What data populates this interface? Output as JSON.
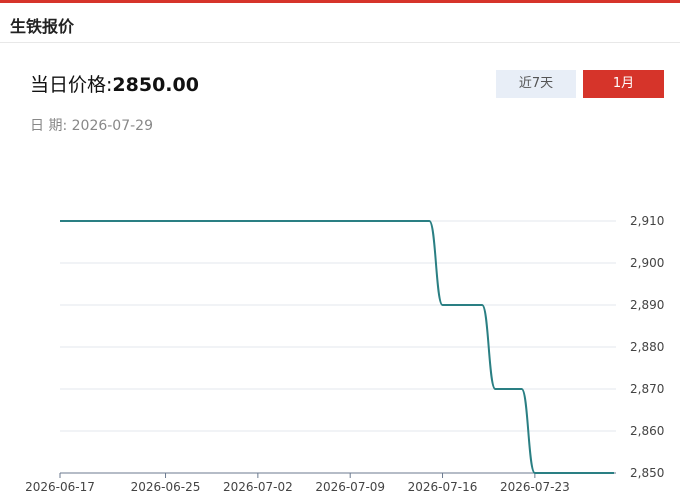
{
  "header": {
    "title": "生铁报价"
  },
  "price": {
    "label": "当日价格:",
    "value": "2850.00"
  },
  "date": {
    "label": "日 期:",
    "value": "2026-07-29"
  },
  "tabs": [
    {
      "label": "近7天",
      "active": false
    },
    {
      "label": "1月",
      "active": true
    }
  ],
  "colors": {
    "accent": "#d6342a",
    "line": "#2a7f83",
    "tab_inactive": "#e8eef7",
    "grid": "#e3e7ee"
  },
  "chart_data": {
    "type": "line",
    "title": "",
    "xlabel": "",
    "ylabel": "",
    "x": [
      "2026-06-17",
      "2026-06-18",
      "2026-06-19",
      "2026-06-20",
      "2026-06-21",
      "2026-06-22",
      "2026-06-23",
      "2026-06-24",
      "2026-06-25",
      "2026-06-26",
      "2026-06-27",
      "2026-06-28",
      "2026-06-29",
      "2026-06-30",
      "2026-07-01",
      "2026-07-02",
      "2026-07-03",
      "2026-07-04",
      "2026-07-05",
      "2026-07-06",
      "2026-07-07",
      "2026-07-08",
      "2026-07-09",
      "2026-07-10",
      "2026-07-11",
      "2026-07-12",
      "2026-07-13",
      "2026-07-14",
      "2026-07-15",
      "2026-07-16",
      "2026-07-17",
      "2026-07-18",
      "2026-07-19",
      "2026-07-20",
      "2026-07-21",
      "2026-07-22",
      "2026-07-23",
      "2026-07-24",
      "2026-07-25",
      "2026-07-26",
      "2026-07-27",
      "2026-07-28",
      "2026-07-29"
    ],
    "series": [
      {
        "values": [
          2910,
          2910,
          2910,
          2910,
          2910,
          2910,
          2910,
          2910,
          2910,
          2910,
          2910,
          2910,
          2910,
          2910,
          2910,
          2910,
          2910,
          2910,
          2910,
          2910,
          2910,
          2910,
          2910,
          2910,
          2910,
          2910,
          2910,
          2910,
          2910,
          2890,
          2890,
          2890,
          2890,
          2870,
          2870,
          2870,
          2850,
          2850,
          2850,
          2850,
          2850,
          2850,
          2850
        ]
      }
    ],
    "x_tick_labels": [
      "2026-06-17",
      "2026-06-25",
      "2026-07-02",
      "2026-07-09",
      "2026-07-16",
      "2026-07-23"
    ],
    "y_ticks": [
      2850,
      2860,
      2870,
      2880,
      2890,
      2900,
      2910
    ],
    "y_tick_labels": [
      "2,850",
      "2,860",
      "2,870",
      "2,880",
      "2,890",
      "2,900",
      "2,910"
    ],
    "ylim": [
      2850,
      2910
    ],
    "grid": true,
    "y_axis_side": "right"
  }
}
